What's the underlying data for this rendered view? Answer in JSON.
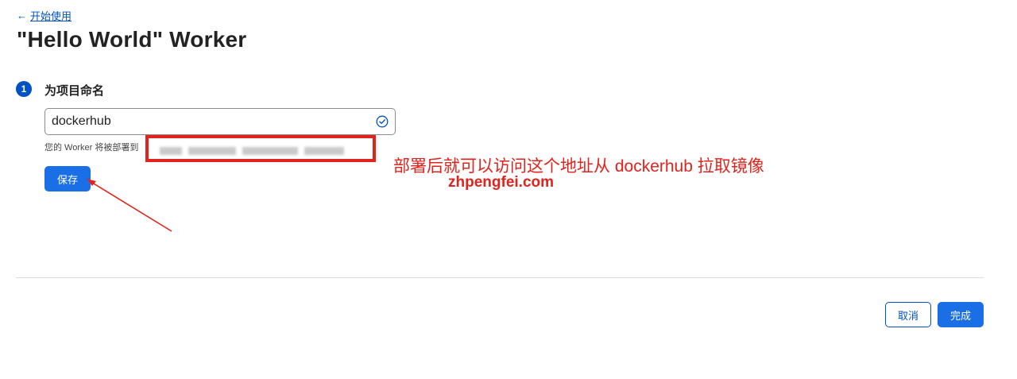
{
  "nav": {
    "back_arrow": "←",
    "back_label": "开始使用"
  },
  "page": {
    "title": "\"Hello World\" Worker"
  },
  "step": {
    "number": "1",
    "title": "为项目命名"
  },
  "form": {
    "name_value": "dockerhub",
    "deploy_hint": "您的 Worker 将被部署到",
    "save_label": "保存"
  },
  "annotation": {
    "text": "部署后就可以访问这个地址从 dockerhub 拉取镜像",
    "watermark": "zhpengfei.com",
    "color": "#e0231c"
  },
  "footer": {
    "cancel_label": "取消",
    "done_label": "完成"
  },
  "colors": {
    "accent": "#1b6fe6",
    "link": "#0051c3",
    "annotation": "#e0231c"
  },
  "icons": {
    "back": "arrow-left-icon",
    "valid": "check-circle-icon"
  }
}
